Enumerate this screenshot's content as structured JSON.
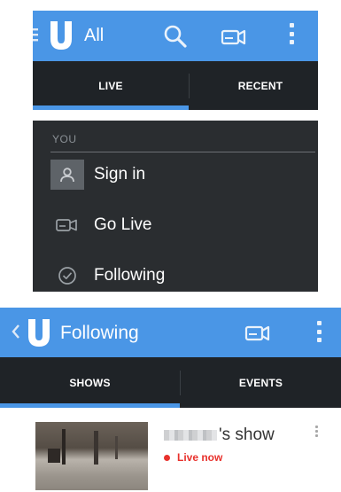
{
  "screen_top": {
    "actionbar": {
      "title": "All",
      "icons": [
        "menu-drawer-icon",
        "logo-u-icon",
        "search-icon",
        "broadcast-camera-icon",
        "overflow-menu-icon"
      ]
    },
    "tabs": [
      {
        "label": "LIVE",
        "selected": true
      },
      {
        "label": "RECENT",
        "selected": false
      }
    ],
    "drawer": {
      "section_header": "YOU",
      "items": [
        {
          "label": "Sign in",
          "icon": "person-icon"
        },
        {
          "label": "Go Live",
          "icon": "broadcast-camera-icon"
        },
        {
          "label": "Following",
          "icon": "check-circle-icon"
        }
      ]
    }
  },
  "screen_bottom": {
    "actionbar": {
      "title": "Following",
      "icons": [
        "back-chevron-icon",
        "logo-u-icon",
        "broadcast-camera-icon",
        "overflow-menu-icon"
      ]
    },
    "tabs": [
      {
        "label": "SHOWS",
        "selected": true
      },
      {
        "label": "EVENTS",
        "selected": false
      }
    ],
    "shows": [
      {
        "title_suffix": "'s show",
        "status": "Live now"
      }
    ]
  },
  "colors": {
    "actionbar_blue": "#4a96e6",
    "tab_bg": "#1f2327",
    "drawer_bg": "#2a2d30",
    "live_red": "#e8312c"
  },
  "u": "U"
}
